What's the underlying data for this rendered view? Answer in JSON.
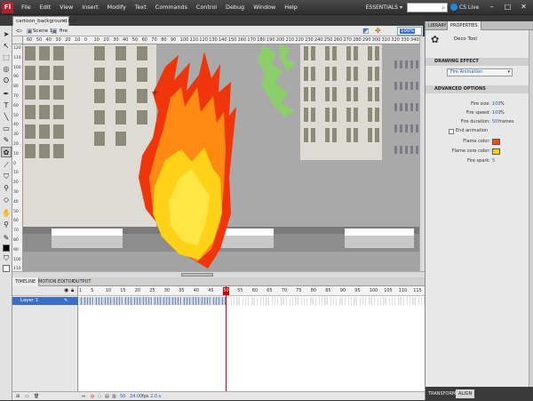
{
  "app": {
    "logo": "Fl"
  },
  "menu": [
    "File",
    "Edit",
    "View",
    "Insert",
    "Modify",
    "Text",
    "Commands",
    "Control",
    "Debug",
    "Window",
    "Help"
  ],
  "workspace": {
    "label": "ESSENTIALS",
    "arrow": "▾"
  },
  "cslive": "CS Live",
  "window_buttons": [
    "–",
    "□",
    "✕"
  ],
  "document": {
    "tab": "cartoon_background.fla*",
    "close": "×"
  },
  "editbar": {
    "scene": "Scene 1",
    "symbol": "fire",
    "zoom": "100%"
  },
  "ruler_top": [
    "60",
    "50",
    "40",
    "30",
    "20",
    "10",
    "0",
    "10",
    "20",
    "30",
    "40",
    "50",
    "60",
    "70",
    "80",
    "90",
    "100",
    "110",
    "120",
    "130",
    "140",
    "150",
    "160",
    "170",
    "180",
    "190",
    "200",
    "210",
    "220",
    "230",
    "240",
    "250",
    "260",
    "270",
    "280",
    "290",
    "300",
    "310",
    "320",
    "330",
    "340"
  ],
  "ruler_left": [
    "120",
    "110",
    "100",
    "90",
    "80",
    "70",
    "60",
    "50",
    "40",
    "30",
    "20",
    "10",
    "0",
    "10",
    "20",
    "30",
    "40",
    "50",
    "60",
    "70",
    "80",
    "90",
    "100",
    "110"
  ],
  "timeline": {
    "tabs": [
      "TIMELINE",
      "MOTION EDITOR",
      "OUTPUT"
    ],
    "layer": "Layer 1",
    "frame_numbers": [
      "1",
      "5",
      "10",
      "15",
      "20",
      "25",
      "30",
      "35",
      "40",
      "45",
      "50",
      "55",
      "60",
      "65",
      "70",
      "75",
      "80",
      "85",
      "90",
      "95",
      "100",
      "105",
      "110",
      "115"
    ],
    "playhead": "50",
    "status": {
      "frame": "50",
      "fps": "24.00",
      "fps_unit": "fps",
      "time": "2.0 s"
    }
  },
  "panel": {
    "tabs": [
      "LIBRARY",
      "PROPERTIES"
    ],
    "tool_name": "Deco Tool",
    "drawing_effect_header": "DRAWING EFFECT",
    "drawing_effect_value": "Fire Animation",
    "advanced_header": "ADVANCED OPTIONS",
    "fire_size": {
      "label": "Fire size:",
      "value": "100",
      "unit": "%"
    },
    "fire_speed": {
      "label": "Fire speed:",
      "value": "100",
      "unit": "%"
    },
    "fire_duration": {
      "label": "Fire duration:",
      "value": "50",
      "unit": "frames"
    },
    "end_animation": "End animation",
    "flame_color": {
      "label": "Flame color:",
      "color": "#ff4a12"
    },
    "flame_core_color": {
      "label": "Flame core color:",
      "color": "#ffd200"
    },
    "fire_spark": {
      "label": "Fire spark:",
      "value": "5"
    },
    "bottom_tabs": [
      "TRANSFORM",
      "ALIGN"
    ]
  }
}
